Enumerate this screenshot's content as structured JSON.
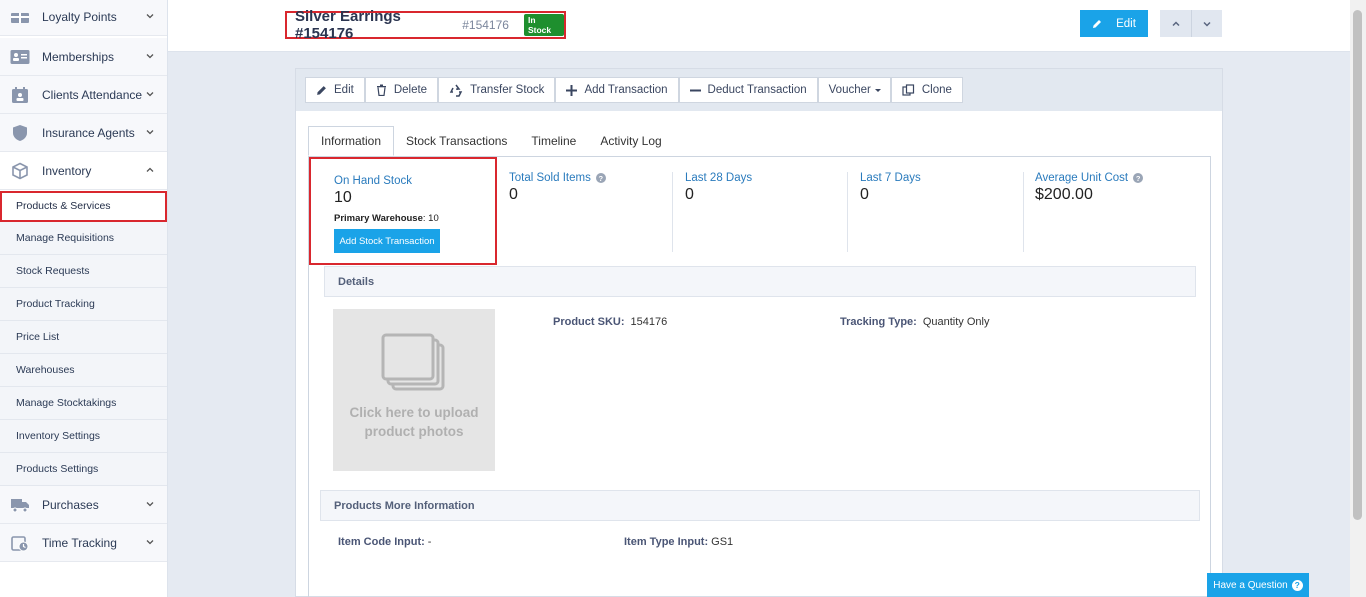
{
  "sidebar": {
    "top_items": [
      {
        "label": "Loyalty Points",
        "icon": "loyalty-icon"
      },
      {
        "label": "Memberships",
        "icon": "membership-card-icon"
      },
      {
        "label": "Clients Attendance",
        "icon": "attendance-icon"
      },
      {
        "label": "Insurance Agents",
        "icon": "shield-icon"
      },
      {
        "label": "Inventory",
        "icon": "box-icon"
      }
    ],
    "inventory_sub": [
      "Products & Services",
      "Manage Requisitions",
      "Stock Requests",
      "Product Tracking",
      "Price List",
      "Warehouses",
      "Manage Stocktakings",
      "Inventory Settings",
      "Products Settings"
    ],
    "bottom_items": [
      {
        "label": "Purchases",
        "icon": "truck-icon"
      },
      {
        "label": "Time Tracking",
        "icon": "clock-calendar-icon"
      }
    ]
  },
  "header": {
    "title": "Silver Earrings #154176",
    "id": "#154176",
    "badge": "In Stock",
    "edit_label": "Edit"
  },
  "toolbar": {
    "edit": "Edit",
    "delete": "Delete",
    "transfer": "Transfer Stock",
    "add_tx": "Add Transaction",
    "deduct_tx": "Deduct Transaction",
    "voucher": "Voucher",
    "clone": "Clone"
  },
  "tabs": [
    "Information",
    "Stock Transactions",
    "Timeline",
    "Activity Log"
  ],
  "stats": {
    "on_hand_label": "On Hand Stock",
    "on_hand_value": "10",
    "primary_wh_label": "Primary Warehouse",
    "primary_wh_value": "10",
    "add_stock_btn": "Add Stock Transaction",
    "total_sold_label": "Total Sold Items",
    "total_sold_value": "0",
    "last28_label": "Last 28 Days",
    "last28_value": "0",
    "last7_label": "Last 7 Days",
    "last7_value": "0",
    "avg_cost_label": "Average Unit Cost",
    "avg_cost_value": "$200.00"
  },
  "details": {
    "heading": "Details",
    "upload_text_1": "Click here to upload",
    "upload_text_2": "product photos",
    "sku_label": "Product SKU:",
    "sku_value": "154176",
    "tracking_label": "Tracking Type:",
    "tracking_value": "Quantity Only"
  },
  "more_info": {
    "heading": "Products More Information",
    "item_code_label": "Item Code Input:",
    "item_code_value": "-",
    "item_type_label": "Item Type Input:",
    "item_type_value": "GS1"
  },
  "help_button": "Have a Question"
}
